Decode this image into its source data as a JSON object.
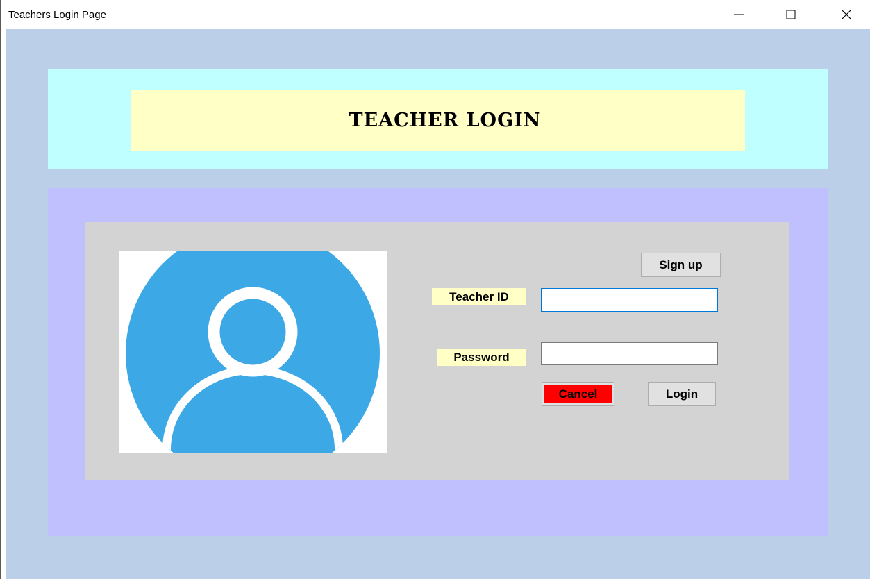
{
  "window": {
    "title": "Teachers Login Page",
    "controls": {
      "minimize_icon": "minimize-icon",
      "maximize_icon": "maximize-icon",
      "close_icon": "close-icon"
    }
  },
  "header": {
    "heading": "TEACHER LOGIN"
  },
  "avatar": {
    "icon": "user-avatar-icon",
    "color": "#3ca8e6"
  },
  "form": {
    "signup_label": "Sign up",
    "teacher_id_label": "Teacher ID",
    "teacher_id_value": "",
    "password_label": "Password",
    "password_value": "",
    "cancel_label": "Cancel",
    "login_label": "Login"
  },
  "colors": {
    "client_background": "#bbcfe8",
    "header_panel": "#bfffff",
    "header_box": "#ffffc6",
    "content_panel": "#c0c0ff",
    "form_panel": "#d3d3d3",
    "label_background": "#ffffc6",
    "cancel_background": "#ff0000"
  }
}
